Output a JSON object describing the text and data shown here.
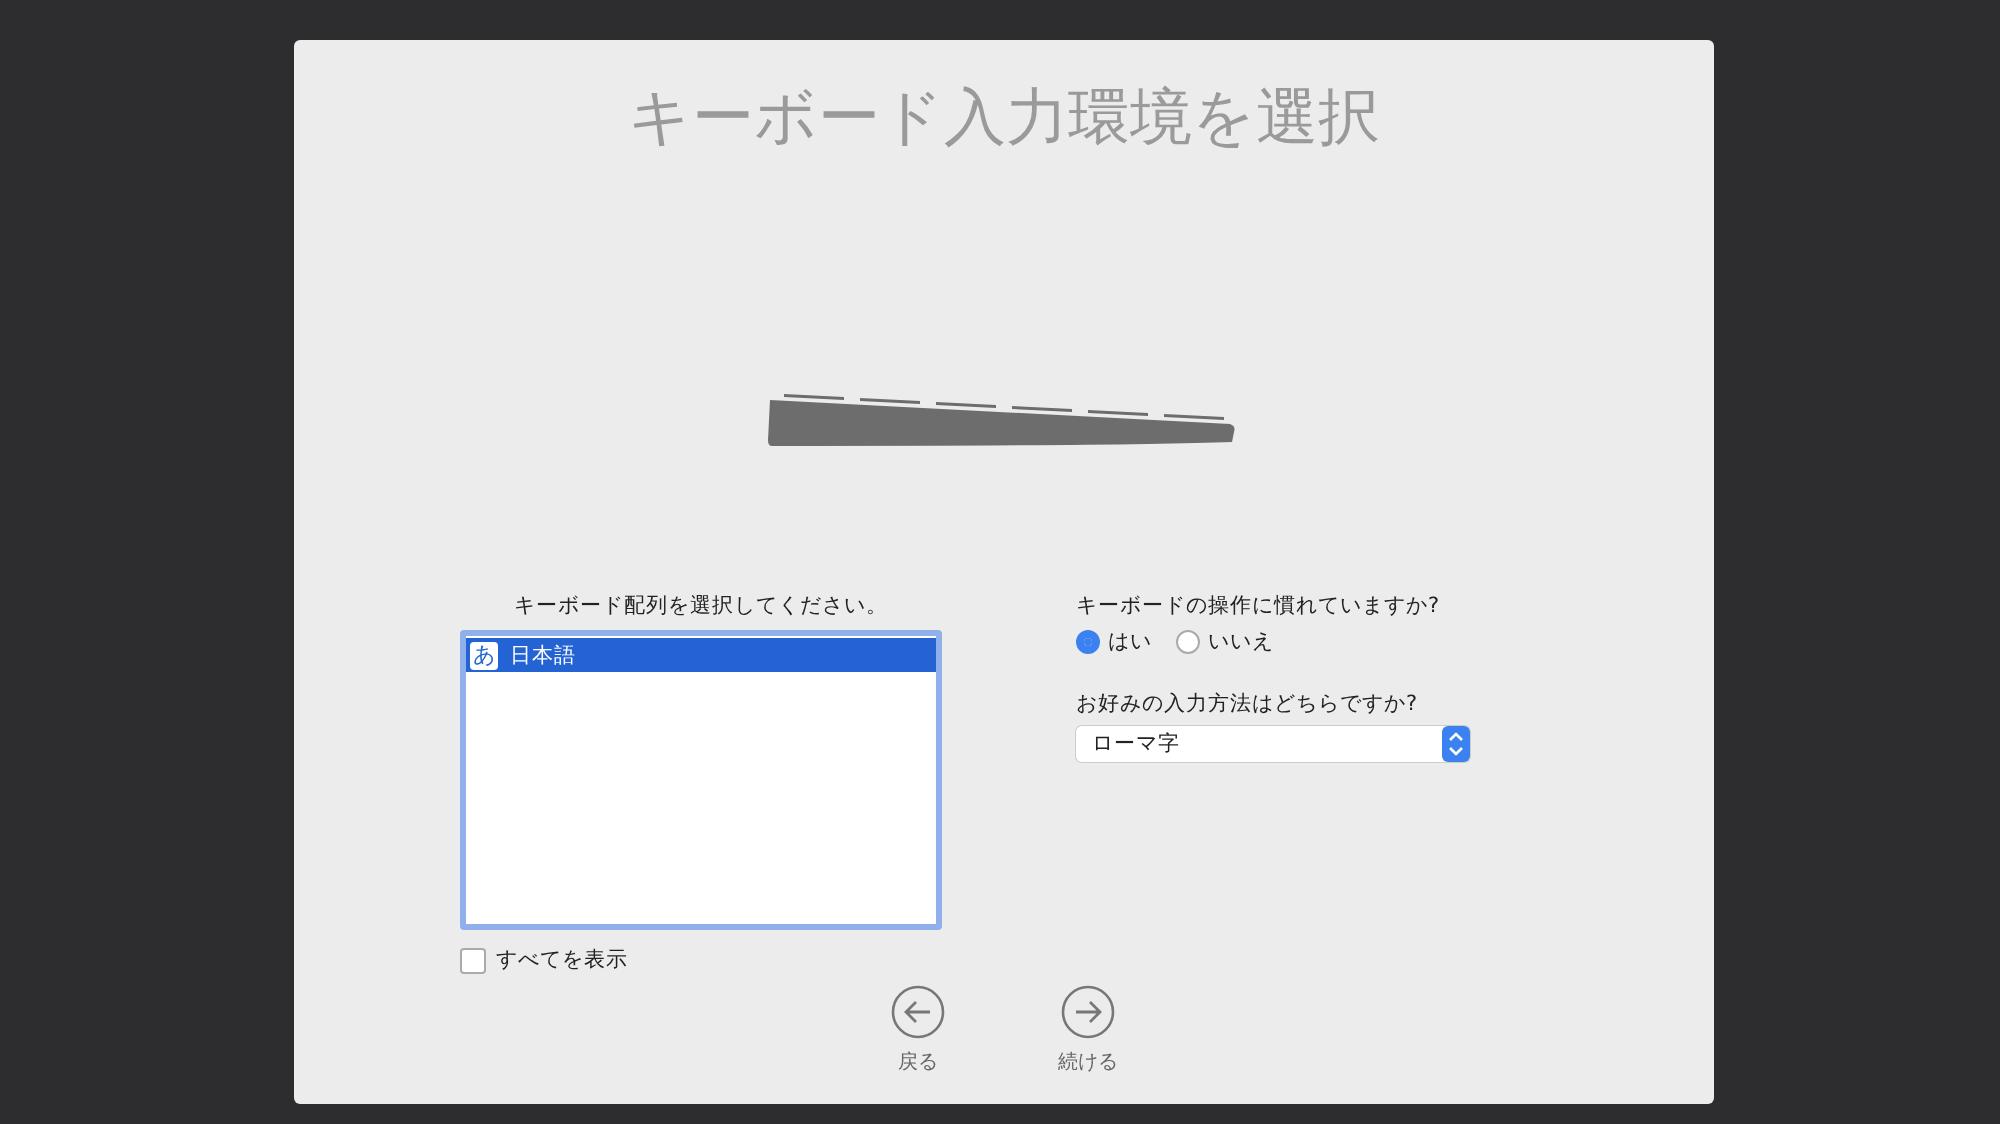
{
  "title": "キーボード入力環境を選択",
  "layout_list": {
    "label": "キーボード配列を選択してください。",
    "items": [
      {
        "icon": "あ",
        "name": "日本語",
        "selected": true
      }
    ]
  },
  "show_all": {
    "label": "すべてを表示",
    "checked": false
  },
  "familiarity": {
    "question": "キーボードの操作に慣れていますか?",
    "options": [
      {
        "label": "はい",
        "selected": true
      },
      {
        "label": "いいえ",
        "selected": false
      }
    ]
  },
  "input_method": {
    "question": "お好みの入力方法はどちらですか?",
    "value": "ローマ字"
  },
  "buttons": [
    {
      "kind": "back",
      "label": "戻る"
    },
    {
      "kind": "next",
      "label": "続ける"
    }
  ]
}
